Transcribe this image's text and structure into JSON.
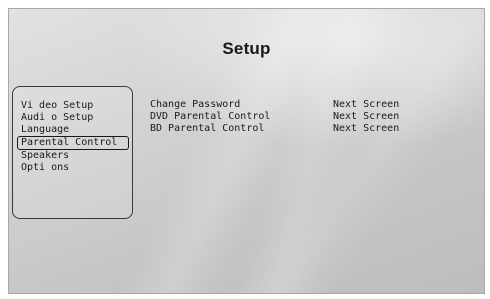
{
  "header": {
    "title": "Setup"
  },
  "menu": {
    "selected_index": 3,
    "items": [
      {
        "label": "Vi deo Setup"
      },
      {
        "label": "Audi o Setup"
      },
      {
        "label": "Language"
      },
      {
        "label": "Parental Control"
      },
      {
        "label": "Speakers"
      },
      {
        "label": "Opti ons"
      }
    ]
  },
  "submenu": {
    "items": [
      {
        "label": "Change Password",
        "value": "Next Screen"
      },
      {
        "label": "DVD Parental Control",
        "value": "Next Screen"
      },
      {
        "label": "BD Parental Control",
        "value": "Next Screen"
      }
    ]
  },
  "colors": {
    "text": "#1a1a1a",
    "background": "#cfcfcf",
    "panel_border": "#3a3a3a"
  }
}
